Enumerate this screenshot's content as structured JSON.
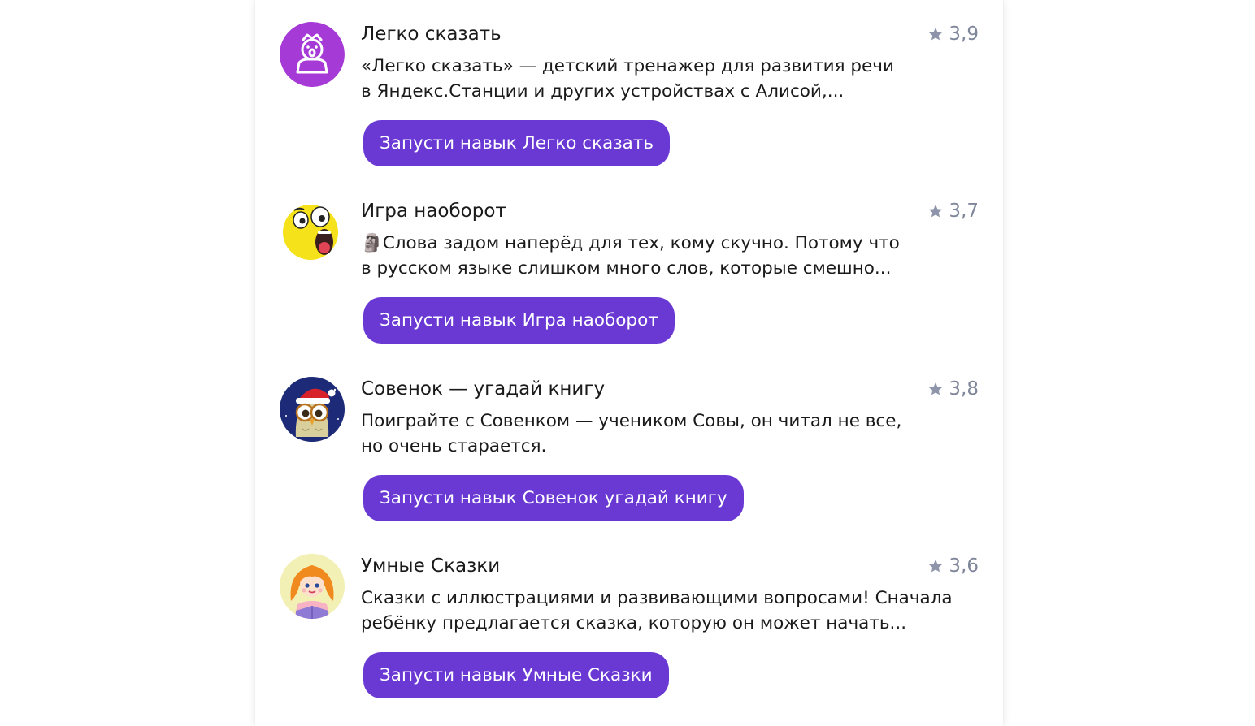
{
  "colors": {
    "button_bg": "#6a39d4",
    "button_text": "#ffffff",
    "rating_text": "#7f869a",
    "text": "#1a1a1a"
  },
  "skills": [
    {
      "title": "Легко сказать",
      "rating": "3,9",
      "description_lines": [
        "«Легко сказать» — детский тренажер для развития речи",
        "в Яндекс.Станции и других устройствах с Алисой,..."
      ],
      "button_label": "Запусти навык Легко сказать",
      "icon": "legko-skazat-icon"
    },
    {
      "title": "Игра наоборот",
      "rating": "3,7",
      "description_lines": [
        "🗿Слова задом наперёд для тех, кому скучно. Потому что",
        "в русском языке слишком много слов, которые смешно..."
      ],
      "button_label": "Запусти навык Игра наоборот",
      "icon": "surprised-emoji-icon"
    },
    {
      "title": "Совенок — угадай книгу",
      "rating": "3,8",
      "description_lines": [
        "Поиграйте с Совенком — учеником Совы, он читал не все,",
        "но очень старается."
      ],
      "button_label": "Запусти навык Совенок угадай книгу",
      "icon": "owl-santa-hat-icon"
    },
    {
      "title": "Умные Сказки",
      "rating": "3,6",
      "description_lines": [
        "Сказки с иллюстрациями и развивающими вопросами! Сначала",
        "ребёнку предлагается сказка, которую он может начать..."
      ],
      "button_label": "Запусти навык Умные Сказки",
      "icon": "girl-reading-icon"
    }
  ]
}
